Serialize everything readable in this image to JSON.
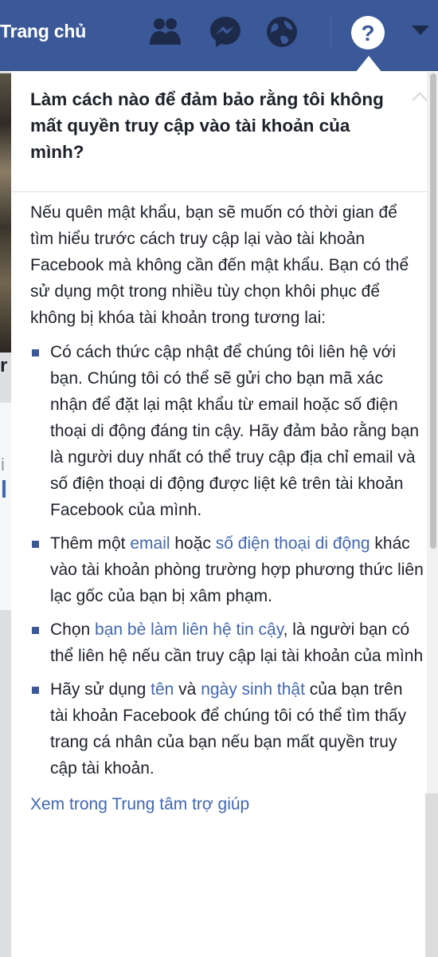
{
  "topbar": {
    "home_label": "Trang chủ",
    "icons": [
      "friends-icon",
      "messenger-icon",
      "globe-icon",
      "help-icon",
      "caret-down-icon"
    ],
    "colors": {
      "bar": "#3b5998",
      "icon": "#1d2a4a"
    }
  },
  "help": {
    "question": "Làm cách nào để đảm bảo rằng tôi không mất quyền truy cập vào tài khoản của mình?",
    "intro": "Nếu quên mật khẩu, bạn sẽ muốn có thời gian để tìm hiểu trước cách truy cập lại vào tài khoản Facebook mà không cần đến mật khẩu. Bạn có thể sử dụng một trong nhiều tùy chọn khôi phục để không bị khóa tài khoản trong tương lai:",
    "bullets": {
      "b1": "Có cách thức cập nhật để chúng tôi liên hệ với bạn. Chúng tôi có thể sẽ gửi cho bạn mã xác nhận để đặt lại mật khẩu từ email hoặc số điện thoại di động đáng tin cậy. Hãy đảm bảo rằng bạn là người duy nhất có thể truy cập địa chỉ email và số điện thoại di động được liệt kê trên tài khoản Facebook của mình.",
      "b2": {
        "t1": "Thêm một ",
        "l1": "email",
        "t2": " hoặc ",
        "l2": "số điện thoại di động",
        "t3": " khác vào tài khoản phòng trường hợp phương thức liên lạc gốc của bạn bị xâm phạm."
      },
      "b3": {
        "t1": "Chọn ",
        "l1": "bạn bè làm liên hệ tin cậy",
        "t2": ", là người bạn có thể liên hệ nếu cần truy cập lại tài khoản của mình"
      },
      "b4": {
        "t1": "Hãy sử dụng ",
        "l1": "tên",
        "t2": " và ",
        "l2": "ngày sinh thật",
        "t3": " của bạn trên tài khoản Facebook để chúng tôi có thể tìm thấy trang cá nhân của bạn nếu bạn mất quyền truy cập tài khoản."
      }
    },
    "footer_link": "Xem trong Trung tâm trợ giúp",
    "colors": {
      "link": "#4267b2",
      "bullet": "#3b5998",
      "text": "#1d2129"
    }
  }
}
